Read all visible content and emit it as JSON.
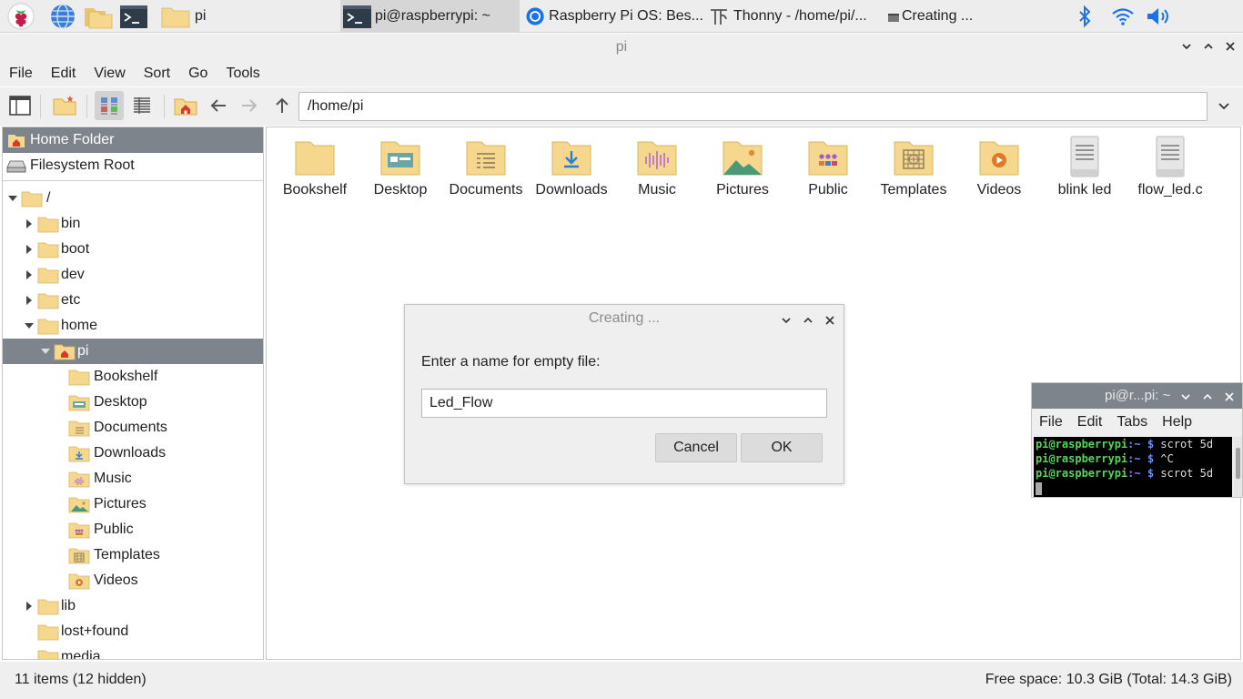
{
  "taskbar": {
    "tasks": [
      {
        "label": "pi"
      },
      {
        "label": "pi@raspberrypi: ~"
      },
      {
        "label": "Raspberry Pi OS: Bes..."
      },
      {
        "label": "Thonny  -  /home/pi/..."
      },
      {
        "label": "Creating ..."
      }
    ]
  },
  "window": {
    "title": "pi",
    "menu": [
      "File",
      "Edit",
      "View",
      "Sort",
      "Go",
      "Tools"
    ],
    "path": "/home/pi"
  },
  "places": [
    {
      "label": "Home Folder"
    },
    {
      "label": "Filesystem Root"
    }
  ],
  "tree": [
    {
      "label": "/"
    },
    {
      "label": "bin"
    },
    {
      "label": "boot"
    },
    {
      "label": "dev"
    },
    {
      "label": "etc"
    },
    {
      "label": "home"
    },
    {
      "label": "pi"
    },
    {
      "label": "Bookshelf"
    },
    {
      "label": "Desktop"
    },
    {
      "label": "Documents"
    },
    {
      "label": "Downloads"
    },
    {
      "label": "Music"
    },
    {
      "label": "Pictures"
    },
    {
      "label": "Public"
    },
    {
      "label": "Templates"
    },
    {
      "label": "Videos"
    },
    {
      "label": "lib"
    },
    {
      "label": "lost+found"
    },
    {
      "label": "media"
    }
  ],
  "files": [
    {
      "name": "Bookshelf",
      "icon": "folder-icon"
    },
    {
      "name": "Desktop",
      "icon": "desktop-folder-icon"
    },
    {
      "name": "Documents",
      "icon": "documents-folder-icon"
    },
    {
      "name": "Downloads",
      "icon": "downloads-folder-icon"
    },
    {
      "name": "Music",
      "icon": "music-folder-icon"
    },
    {
      "name": "Pictures",
      "icon": "pictures-folder-icon"
    },
    {
      "name": "Public",
      "icon": "public-folder-icon"
    },
    {
      "name": "Templates",
      "icon": "templates-folder-icon"
    },
    {
      "name": "Videos",
      "icon": "videos-folder-icon"
    },
    {
      "name": "blink led",
      "icon": "text-file-icon"
    },
    {
      "name": "flow_led.c",
      "icon": "text-file-icon"
    }
  ],
  "status": {
    "left": "11 items (12 hidden)",
    "right": "Free space: 10.3 GiB (Total: 14.3 GiB)"
  },
  "dialog": {
    "title": "Creating ...",
    "prompt": "Enter a name for empty file:",
    "value": "Led_Flow",
    "cancel": "Cancel",
    "ok": "OK"
  },
  "terminal": {
    "title": "pi@r...pi: ~",
    "menu": [
      "File",
      "Edit",
      "Tabs",
      "Help"
    ],
    "lines": [
      {
        "user": "pi@raspberrypi",
        "path": ":~ $",
        "cmd": " scrot 5d"
      },
      {
        "user": "pi@raspberrypi",
        "path": ":~ $",
        "cmd": " ^C"
      },
      {
        "user": "pi@raspberrypi",
        "path": ":~ $",
        "cmd": " scrot 5d"
      }
    ]
  },
  "colors": {
    "selection": "#7e848b",
    "folder": "#f5d78e",
    "accent_blue": "#1a73e8"
  }
}
